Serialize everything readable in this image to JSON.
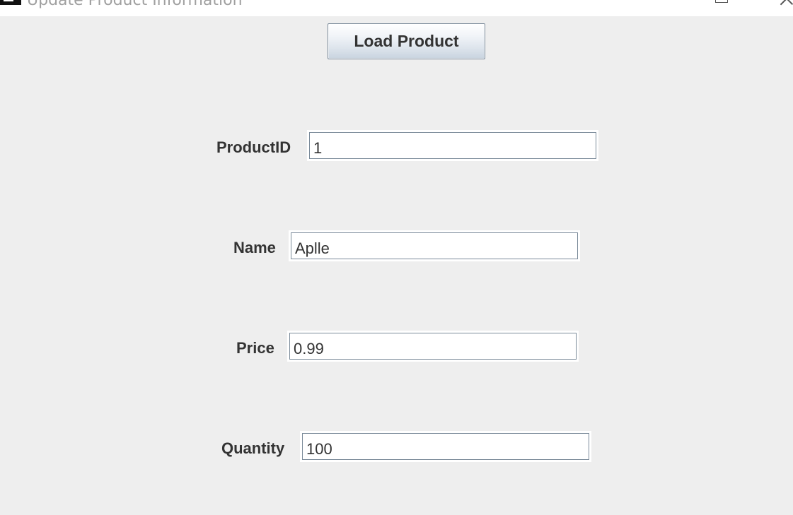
{
  "window": {
    "title": "Update Product Information"
  },
  "toolbar": {
    "load_label": "Load Product"
  },
  "form": {
    "product_id": {
      "label": "ProductID",
      "value": "1"
    },
    "name": {
      "label": "Name",
      "value": "Aplle"
    },
    "price": {
      "label": "Price",
      "value": "0.99"
    },
    "quantity": {
      "label": "Quantity",
      "value": "100"
    }
  }
}
